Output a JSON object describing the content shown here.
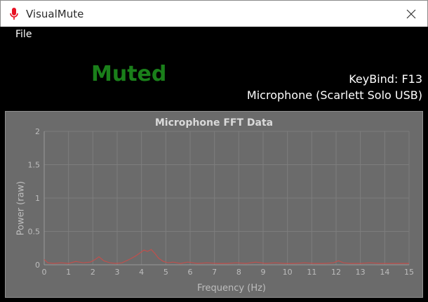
{
  "window": {
    "title": "VisualMute"
  },
  "menu": {
    "file_label": "File"
  },
  "status": {
    "text": "Muted",
    "color": "#1a7f1a"
  },
  "keybind": {
    "text": "KeyBind: F13"
  },
  "device": {
    "text": "Microphone (Scarlett Solo USB)"
  },
  "icons": {
    "app": "microphone-icon",
    "close": "close-icon"
  },
  "chart_data": {
    "type": "line",
    "title": "Microphone FFT Data",
    "xlabel": "Frequency (Hz)",
    "ylabel": "Power (raw)",
    "xlim": [
      0,
      15
    ],
    "ylim": [
      0,
      2
    ],
    "x_ticks": [
      "0",
      "1",
      "2",
      "3",
      "4",
      "5",
      "6",
      "7",
      "8",
      "9",
      "10",
      "11",
      "12",
      "13",
      "14",
      "15"
    ],
    "y_ticks": [
      "0",
      "0.5",
      "1",
      "1.5",
      "2"
    ],
    "grid": true,
    "series": [
      {
        "color": "#c0504d",
        "x": [
          0,
          0.15,
          0.4,
          0.7,
          1.0,
          1.3,
          1.6,
          1.9,
          2.1,
          2.25,
          2.45,
          2.7,
          2.95,
          3.2,
          3.5,
          3.75,
          3.95,
          4.1,
          4.25,
          4.4,
          4.55,
          4.7,
          4.9,
          5.1,
          5.3,
          5.6,
          5.9,
          6.3,
          6.7,
          7.1,
          7.5,
          7.9,
          8.3,
          8.7,
          9.1,
          9.5,
          9.9,
          10.3,
          10.7,
          11.1,
          11.5,
          11.9,
          12.1,
          12.3,
          12.6,
          13.0,
          13.4,
          13.8,
          14.2,
          14.6,
          15.0
        ],
        "y": [
          0.08,
          0.03,
          0.02,
          0.03,
          0.02,
          0.05,
          0.03,
          0.04,
          0.08,
          0.12,
          0.06,
          0.03,
          0.02,
          0.03,
          0.08,
          0.13,
          0.18,
          0.22,
          0.2,
          0.23,
          0.17,
          0.1,
          0.05,
          0.03,
          0.04,
          0.02,
          0.04,
          0.02,
          0.03,
          0.02,
          0.02,
          0.03,
          0.02,
          0.04,
          0.02,
          0.03,
          0.02,
          0.02,
          0.03,
          0.02,
          0.02,
          0.03,
          0.06,
          0.03,
          0.02,
          0.02,
          0.03,
          0.02,
          0.02,
          0.02,
          0.02
        ]
      }
    ]
  }
}
